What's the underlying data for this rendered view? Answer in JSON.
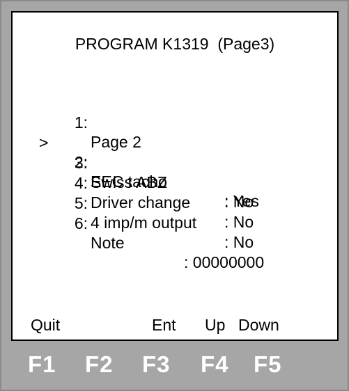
{
  "title": "PROGRAM K1319  (Page3)",
  "cursor": ">",
  "menu": [
    {
      "num": "1:",
      "label": "Page 2",
      "value": ""
    },
    {
      "num": "2:",
      "label": "EEC tacho",
      "value": ": Yes"
    },
    {
      "num": "3:",
      "label": "Swiss ABZ",
      "value": ": No"
    },
    {
      "num": "4:",
      "label": "Driver change",
      "value": ": No"
    },
    {
      "num": "5:",
      "label": "4 imp/m output",
      "value": ": No"
    },
    {
      "num": "6:",
      "label": "Note",
      "value": ": 00000000"
    }
  ],
  "softkeys": {
    "f1": "Quit",
    "f2": "",
    "f3": "Ent",
    "f4": "Up",
    "f5": "Down"
  },
  "function_keys": [
    "F1",
    "F2",
    "F3",
    "F4",
    "F5"
  ],
  "colors": {
    "panel": "#a6a6a6",
    "screen": "#ffffff",
    "key_text": "#ffffff"
  }
}
